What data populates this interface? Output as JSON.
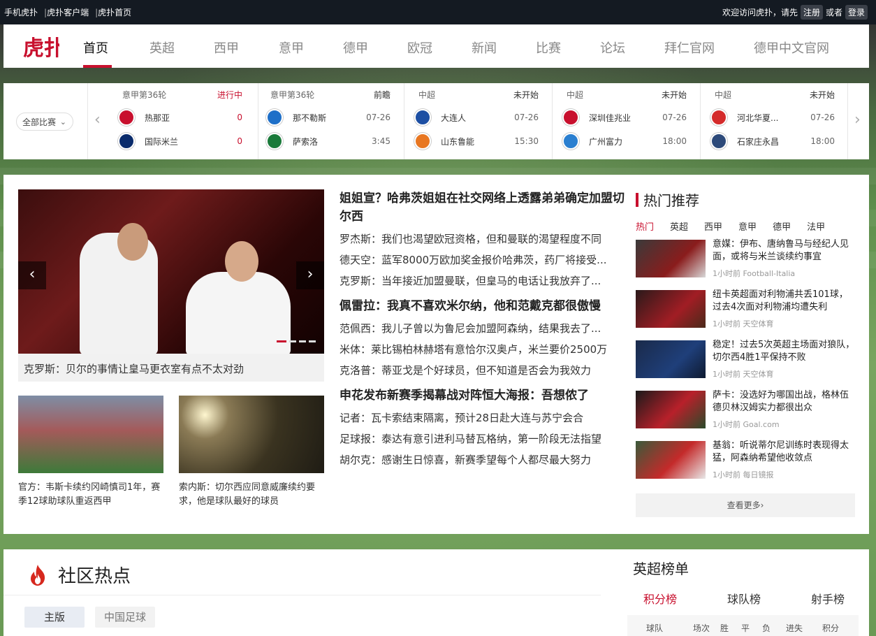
{
  "topbar": {
    "links": [
      "手机虎扑",
      "虎扑客户端",
      "虎扑首页"
    ],
    "separator": "|",
    "welcome": "欢迎访问虎扑，请先",
    "register": "注册",
    "or": "或者",
    "login": "登录"
  },
  "nav": {
    "logo_text": "虎扑",
    "items": [
      "首页",
      "英超",
      "西甲",
      "意甲",
      "德甲",
      "欧冠",
      "新闻",
      "比赛",
      "论坛",
      "拜仁官网",
      "德甲中文官网"
    ],
    "active_index": 0
  },
  "scores": {
    "all_matches": "全部比赛",
    "matches": [
      {
        "league": "意甲第36轮",
        "status": "进行中",
        "live": true,
        "home": "热那亚",
        "away": "国际米兰",
        "home_val": "0",
        "away_val": "0",
        "home_color": "#c8102e",
        "away_color": "#0a2b6b"
      },
      {
        "league": "意甲第36轮",
        "status": "前瞻",
        "live": false,
        "home": "那不勒斯",
        "away": "萨索洛",
        "home_val": "07-26",
        "away_val": "3:45",
        "home_color": "#1e6fc8",
        "away_color": "#1a7a3a"
      },
      {
        "league": "中超",
        "status": "未开始",
        "live": false,
        "home": "大连人",
        "away": "山东鲁能",
        "home_val": "07-26",
        "away_val": "15:30",
        "home_color": "#1d4fa3",
        "away_color": "#e87722"
      },
      {
        "league": "中超",
        "status": "未开始",
        "live": false,
        "home": "深圳佳兆业",
        "away": "广州富力",
        "home_val": "07-26",
        "away_val": "18:00",
        "home_color": "#c8102e",
        "away_color": "#2a7fd0"
      },
      {
        "league": "中超",
        "status": "未开始",
        "live": false,
        "home": "河北华夏...",
        "away": "石家庄永昌",
        "home_val": "07-26",
        "away_val": "18:00",
        "home_color": "#d42b2b",
        "away_color": "#2d4a7a"
      }
    ]
  },
  "hero": {
    "caption": "克罗斯：贝尔的事情让皇马更衣室有点不太对劲",
    "prev": "‹",
    "next": "›"
  },
  "thumbs": [
    {
      "caption": "官方：韦斯卡续约冈崎慎司1年，赛季12球助球队重返西甲"
    },
    {
      "caption": "索内斯：切尔西应同意威廉续约要求，他是球队最好的球员"
    }
  ],
  "news": [
    {
      "headline": "姐姐宣？哈弗茨姐姐在社交网络上透露弟弟确定加盟切尔西",
      "lines": [
        "罗杰斯：我们也渴望欧冠资格，但和曼联的渴望程度不同",
        "德天空：蓝军8000万欧加奖金报价哈弗茨，药厂将接受...",
        "克罗斯：当年接近加盟曼联，但皇马的电话让我放弃了..."
      ]
    },
    {
      "headline": "佩雷拉：我真不喜欢米尔纳，他和范戴克都很傲慢",
      "lines": [
        "范佩西：我儿子曾以为鲁尼会加盟阿森纳，结果我去了...",
        "米体：莱比锡柏林赫塔有意恰尔汉奥卢，米兰要价2500万",
        "克洛普：蒂亚戈是个好球员，但不知道是否会为我效力"
      ]
    },
    {
      "headline": "申花发布新赛季揭幕战对阵恒大海报：吾想侬了",
      "lines": [
        "记者：瓦卡索结束隔离，预计28日赴大连与苏宁会合",
        "足球报：泰达有意引进利马替瓦格纳，第一阶段无法指望",
        "胡尔克：感谢生日惊喜，新赛季望每个人都尽最大努力"
      ]
    }
  ],
  "hot": {
    "title": "热门推荐",
    "tabs": [
      "热门",
      "英超",
      "西甲",
      "意甲",
      "德甲",
      "法甲"
    ],
    "active_tab": 0,
    "items": [
      {
        "title": "意媒：伊布、唐纳鲁马与经纪人见面，或将与米兰谈续约事宜",
        "meta": "1小时前 Football-Italia",
        "color": "#8a1c1c"
      },
      {
        "title": "纽卡英超面对利物浦共丢101球，过去4次面对利物浦均遭失利",
        "meta": "1小时前 天空体育",
        "color": "#a11d24"
      },
      {
        "title": "稳定！过去5次英超主场面对狼队，切尔西4胜1平保持不败",
        "meta": "1小时前 天空体育",
        "color": "#1f3f7a"
      },
      {
        "title": "萨卡：没选好为哪国出战，格林伍德贝林汉姆实力都很出众",
        "meta": "1小时前 Goal.com",
        "color": "#b8202a"
      },
      {
        "title": "基翁：听说蒂尔尼训练时表现得太猛，阿森纳希望他收敛点",
        "meta": "1小时前 每日镜报",
        "color": "#c42a2a"
      }
    ],
    "more": "查看更多›"
  },
  "community": {
    "title": "社区热点",
    "tabs": [
      "主版",
      "中国足球"
    ]
  },
  "ranking": {
    "title": "英超榜单",
    "tabs": [
      "积分榜",
      "球队榜",
      "射手榜"
    ],
    "columns": [
      "球队",
      "场次",
      "胜",
      "平",
      "负",
      "进失",
      "积分"
    ]
  },
  "colors": {
    "accent": "#c8102e",
    "topbar_bg": "#141a22"
  }
}
